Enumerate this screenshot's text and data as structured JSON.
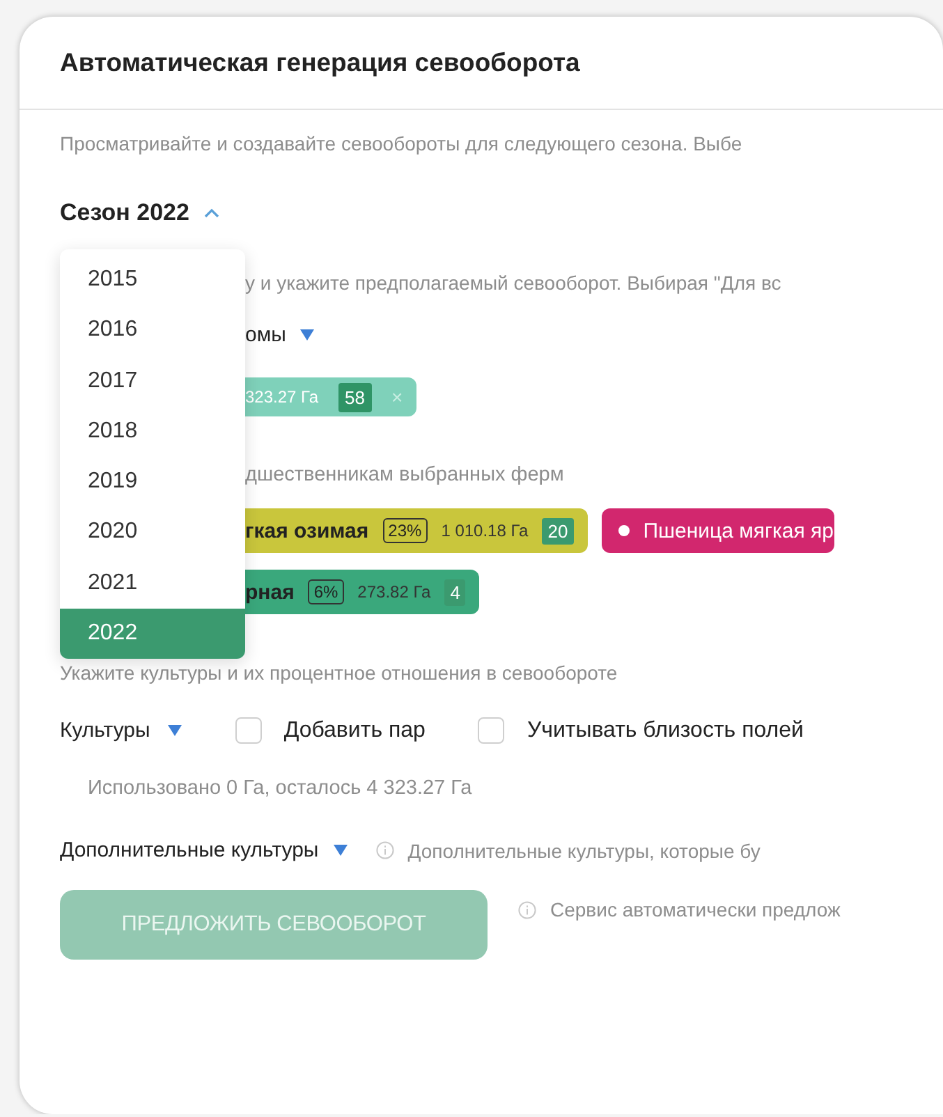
{
  "title": "Автоматическая генерация севооборота",
  "description": "Просматривайте и создавайте севообороты для следующего сезона. Выбе",
  "season": {
    "label": "Сезон 2022",
    "expanded": true
  },
  "season_menu": [
    {
      "label": "2015",
      "selected": false
    },
    {
      "label": "2016",
      "selected": false
    },
    {
      "label": "2017",
      "selected": false
    },
    {
      "label": "2018",
      "selected": false
    },
    {
      "label": "2019",
      "selected": false
    },
    {
      "label": "2020",
      "selected": false
    },
    {
      "label": "2021",
      "selected": false
    },
    {
      "label": "2022",
      "selected": true
    }
  ],
  "farm_hint": "у и укажите предполагаемый севооборот. Выбирая \"Для вс",
  "farm_select": {
    "label": "омы",
    "expanded": false
  },
  "farm_chip": {
    "area": "323.27 Га",
    "count": "58",
    "remove": "×",
    "color": "#7fd1ba"
  },
  "predecessors_hint": "дшественникам выбранных ферм",
  "predecessor_chips": [
    {
      "kind": "detailed",
      "name": "гкая озимая",
      "share": "23%",
      "area": "1 010.18 Га",
      "count": "20",
      "color": "#c9c63c"
    },
    {
      "kind": "dotted",
      "name": "Пшеница мягкая яр",
      "color": "#d2276e"
    },
    {
      "kind": "detailed",
      "name": "рная",
      "share": "6%",
      "area": "273.82 Га",
      "count": "4",
      "color": "#3aa87c"
    }
  ],
  "cultures_hint": "Укажите культуры и их процентное отношения в севообороте",
  "cultures_select": {
    "label": "Культуры",
    "expanded": false
  },
  "options": [
    {
      "label": "Добавить пар",
      "checked": false
    },
    {
      "label": "Учитывать близость полей",
      "checked": false
    }
  ],
  "usage": "Использовано 0 Га, осталось 4 323.27 Га",
  "extra_select": {
    "label": "Дополнительные культуры",
    "expanded": false
  },
  "extra_hint": "Дополнительные культуры, которые бу",
  "submit": {
    "label": "ПРЕДЛОЖИТЬ СЕВООБОРОТ",
    "disabled": true
  },
  "submit_hint": "Сервис автоматически предлож"
}
